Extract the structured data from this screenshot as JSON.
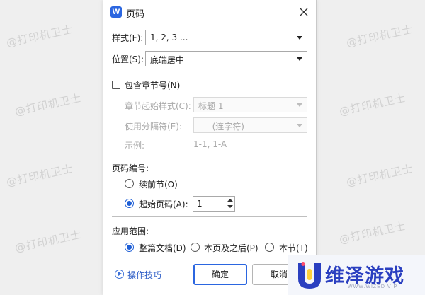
{
  "watermark": "@打印机卫士",
  "dialog": {
    "app_icon_letter": "W",
    "title": "页码",
    "style_label": "样式(F):",
    "style_value": "1, 2, 3 ...",
    "position_label": "位置(S):",
    "position_value": "底端居中",
    "include_chapter_label": "包含章节号(N)",
    "chapter_style_label": "章节起始样式(C):",
    "chapter_style_value": "标题 1",
    "separator_label": "使用分隔符(E):",
    "separator_value": "-    (连字符)",
    "example_label": "示例:",
    "example_value": "1-1, 1-A",
    "numbering_group": "页码编号:",
    "continue_label": "续前节(O)",
    "start_label": "起始页码(A):",
    "start_value": "1",
    "apply_group": "应用范围:",
    "apply_whole": "整篇文档(D)",
    "apply_this_after": "本页及之后(P)",
    "apply_section": "本节(T)",
    "tips_link": "操作技巧",
    "ok_label": "确定",
    "cancel_label": "取消"
  },
  "logo": {
    "brand": "维泽游戏",
    "sub": "WWW.WIZED VIP"
  },
  "colors": {
    "accent": "#1f5fd6",
    "link": "#2f5fc7",
    "brand": "#2a3fc0"
  }
}
